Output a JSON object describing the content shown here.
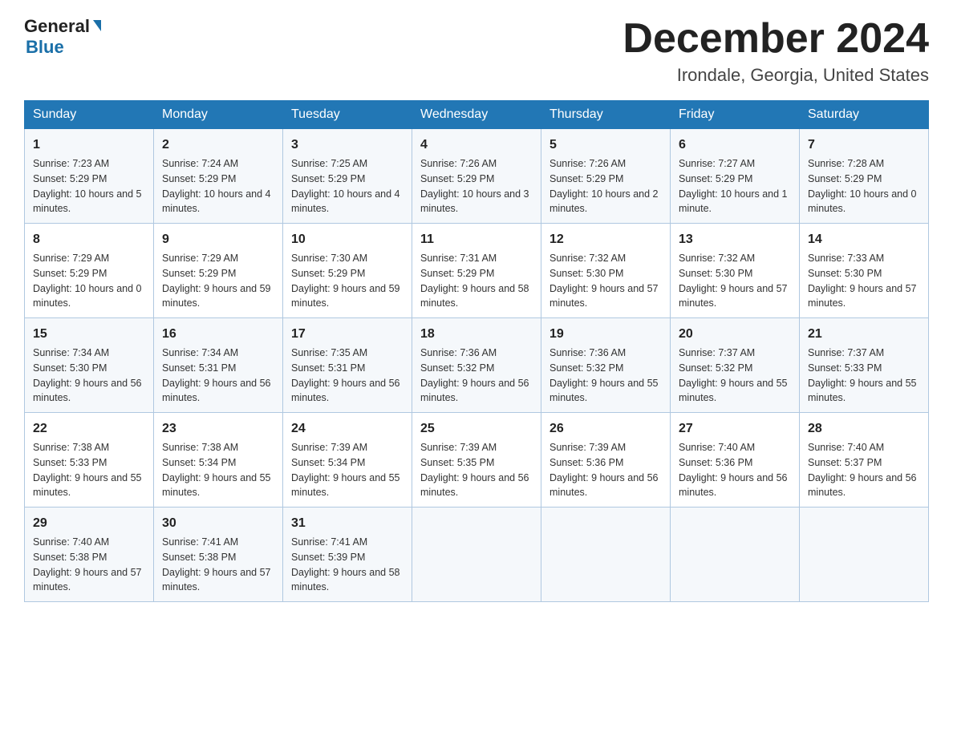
{
  "header": {
    "logo_general": "General",
    "logo_blue": "Blue",
    "month_title": "December 2024",
    "location": "Irondale, Georgia, United States"
  },
  "days_of_week": [
    "Sunday",
    "Monday",
    "Tuesday",
    "Wednesday",
    "Thursday",
    "Friday",
    "Saturday"
  ],
  "weeks": [
    [
      {
        "day": "1",
        "sunrise": "7:23 AM",
        "sunset": "5:29 PM",
        "daylight": "10 hours and 5 minutes."
      },
      {
        "day": "2",
        "sunrise": "7:24 AM",
        "sunset": "5:29 PM",
        "daylight": "10 hours and 4 minutes."
      },
      {
        "day": "3",
        "sunrise": "7:25 AM",
        "sunset": "5:29 PM",
        "daylight": "10 hours and 4 minutes."
      },
      {
        "day": "4",
        "sunrise": "7:26 AM",
        "sunset": "5:29 PM",
        "daylight": "10 hours and 3 minutes."
      },
      {
        "day": "5",
        "sunrise": "7:26 AM",
        "sunset": "5:29 PM",
        "daylight": "10 hours and 2 minutes."
      },
      {
        "day": "6",
        "sunrise": "7:27 AM",
        "sunset": "5:29 PM",
        "daylight": "10 hours and 1 minute."
      },
      {
        "day": "7",
        "sunrise": "7:28 AM",
        "sunset": "5:29 PM",
        "daylight": "10 hours and 0 minutes."
      }
    ],
    [
      {
        "day": "8",
        "sunrise": "7:29 AM",
        "sunset": "5:29 PM",
        "daylight": "10 hours and 0 minutes."
      },
      {
        "day": "9",
        "sunrise": "7:29 AM",
        "sunset": "5:29 PM",
        "daylight": "9 hours and 59 minutes."
      },
      {
        "day": "10",
        "sunrise": "7:30 AM",
        "sunset": "5:29 PM",
        "daylight": "9 hours and 59 minutes."
      },
      {
        "day": "11",
        "sunrise": "7:31 AM",
        "sunset": "5:29 PM",
        "daylight": "9 hours and 58 minutes."
      },
      {
        "day": "12",
        "sunrise": "7:32 AM",
        "sunset": "5:30 PM",
        "daylight": "9 hours and 57 minutes."
      },
      {
        "day": "13",
        "sunrise": "7:32 AM",
        "sunset": "5:30 PM",
        "daylight": "9 hours and 57 minutes."
      },
      {
        "day": "14",
        "sunrise": "7:33 AM",
        "sunset": "5:30 PM",
        "daylight": "9 hours and 57 minutes."
      }
    ],
    [
      {
        "day": "15",
        "sunrise": "7:34 AM",
        "sunset": "5:30 PM",
        "daylight": "9 hours and 56 minutes."
      },
      {
        "day": "16",
        "sunrise": "7:34 AM",
        "sunset": "5:31 PM",
        "daylight": "9 hours and 56 minutes."
      },
      {
        "day": "17",
        "sunrise": "7:35 AM",
        "sunset": "5:31 PM",
        "daylight": "9 hours and 56 minutes."
      },
      {
        "day": "18",
        "sunrise": "7:36 AM",
        "sunset": "5:32 PM",
        "daylight": "9 hours and 56 minutes."
      },
      {
        "day": "19",
        "sunrise": "7:36 AM",
        "sunset": "5:32 PM",
        "daylight": "9 hours and 55 minutes."
      },
      {
        "day": "20",
        "sunrise": "7:37 AM",
        "sunset": "5:32 PM",
        "daylight": "9 hours and 55 minutes."
      },
      {
        "day": "21",
        "sunrise": "7:37 AM",
        "sunset": "5:33 PM",
        "daylight": "9 hours and 55 minutes."
      }
    ],
    [
      {
        "day": "22",
        "sunrise": "7:38 AM",
        "sunset": "5:33 PM",
        "daylight": "9 hours and 55 minutes."
      },
      {
        "day": "23",
        "sunrise": "7:38 AM",
        "sunset": "5:34 PM",
        "daylight": "9 hours and 55 minutes."
      },
      {
        "day": "24",
        "sunrise": "7:39 AM",
        "sunset": "5:34 PM",
        "daylight": "9 hours and 55 minutes."
      },
      {
        "day": "25",
        "sunrise": "7:39 AM",
        "sunset": "5:35 PM",
        "daylight": "9 hours and 56 minutes."
      },
      {
        "day": "26",
        "sunrise": "7:39 AM",
        "sunset": "5:36 PM",
        "daylight": "9 hours and 56 minutes."
      },
      {
        "day": "27",
        "sunrise": "7:40 AM",
        "sunset": "5:36 PM",
        "daylight": "9 hours and 56 minutes."
      },
      {
        "day": "28",
        "sunrise": "7:40 AM",
        "sunset": "5:37 PM",
        "daylight": "9 hours and 56 minutes."
      }
    ],
    [
      {
        "day": "29",
        "sunrise": "7:40 AM",
        "sunset": "5:38 PM",
        "daylight": "9 hours and 57 minutes."
      },
      {
        "day": "30",
        "sunrise": "7:41 AM",
        "sunset": "5:38 PM",
        "daylight": "9 hours and 57 minutes."
      },
      {
        "day": "31",
        "sunrise": "7:41 AM",
        "sunset": "5:39 PM",
        "daylight": "9 hours and 58 minutes."
      },
      null,
      null,
      null,
      null
    ]
  ],
  "labels": {
    "sunrise": "Sunrise:",
    "sunset": "Sunset:",
    "daylight": "Daylight:"
  }
}
